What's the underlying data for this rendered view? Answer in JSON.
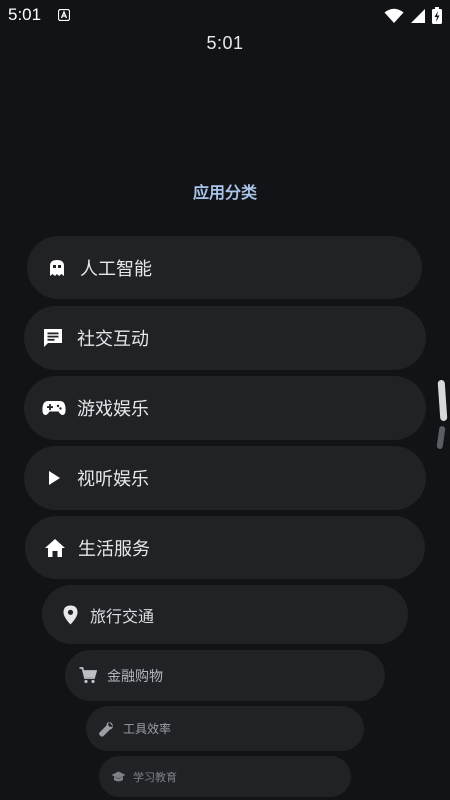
{
  "status_bar": {
    "time": "5:01"
  },
  "clock": {
    "time": "5:01"
  },
  "title": "应用分类",
  "categories": [
    {
      "label": "人工智能",
      "icon": "robot-icon"
    },
    {
      "label": "社交互动",
      "icon": "chat-icon"
    },
    {
      "label": "游戏娱乐",
      "icon": "gamepad-icon"
    },
    {
      "label": "视听娱乐",
      "icon": "play-icon"
    },
    {
      "label": "生活服务",
      "icon": "home-icon"
    },
    {
      "label": "旅行交通",
      "icon": "location-pin-icon"
    },
    {
      "label": "金融购物",
      "icon": "cart-icon"
    },
    {
      "label": "工具效率",
      "icon": "wrench-icon"
    },
    {
      "label": "学习教育",
      "icon": "graduation-cap-icon"
    }
  ],
  "colors": {
    "background": "#121316",
    "item_background": "#202226",
    "title": "#a8c2e8",
    "text": "#e6e7eb"
  }
}
